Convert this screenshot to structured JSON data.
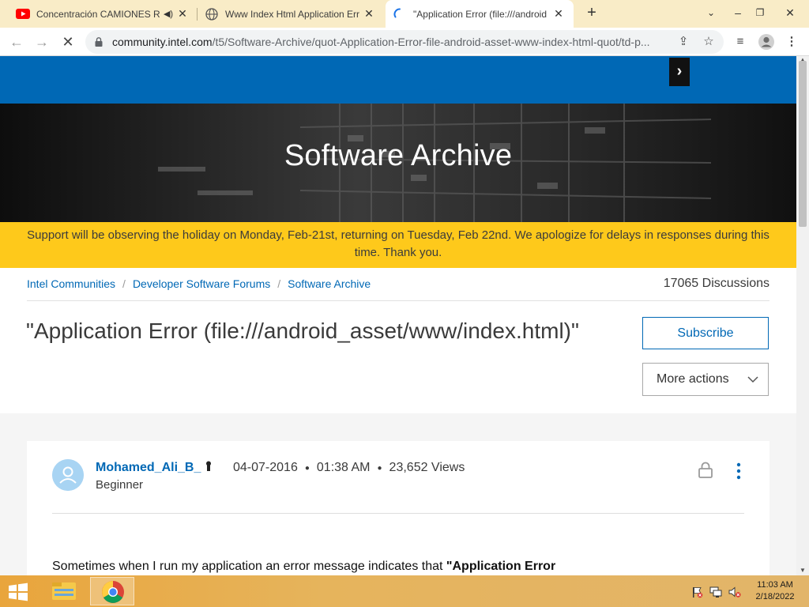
{
  "browser": {
    "tabs": [
      {
        "title": "Concentración CAMIONES R",
        "icon": "youtube-icon",
        "audio": true
      },
      {
        "title": "Www Index Html Application Err",
        "icon": "globe-icon"
      },
      {
        "title": "\"Application Error (file:///android",
        "icon": "loading-spinner-icon",
        "active": true
      }
    ],
    "url_domain": "community.intel.com",
    "url_path": "/t5/Software-Archive/quot-Application-Error-file-android-asset-www-index-html-quot/td-p..."
  },
  "page": {
    "hero_title": "Software Archive",
    "banner_text": "Support will be observing the holiday on Monday, Feb-21st, returning on Tuesday, Feb 22nd. We apologize for delays in responses during this time. Thank you.",
    "breadcrumbs": [
      "Intel Communities",
      "Developer Software Forums",
      "Software Archive"
    ],
    "discussions": "17065 Discussions",
    "post_title": "\"Application Error (file:///android_asset/www/index.html)\"",
    "subscribe_label": "Subscribe",
    "more_actions_label": "More actions",
    "post": {
      "author": "Mohamed_Ali_B_",
      "rank": "Beginner",
      "date": "04-07-2016",
      "time": "01:38 AM",
      "views": "23,652 Views",
      "body_start": "Sometimes when I run my application an error message indicates that ",
      "body_bold": "\"Application Error"
    }
  },
  "taskbar": {
    "clock_time": "11:03 AM",
    "clock_date": "2/18/2022"
  },
  "colors": {
    "intel_blue": "#0068b5",
    "banner_yellow": "#fec91b",
    "tab_strip": "#f9ecc7"
  }
}
